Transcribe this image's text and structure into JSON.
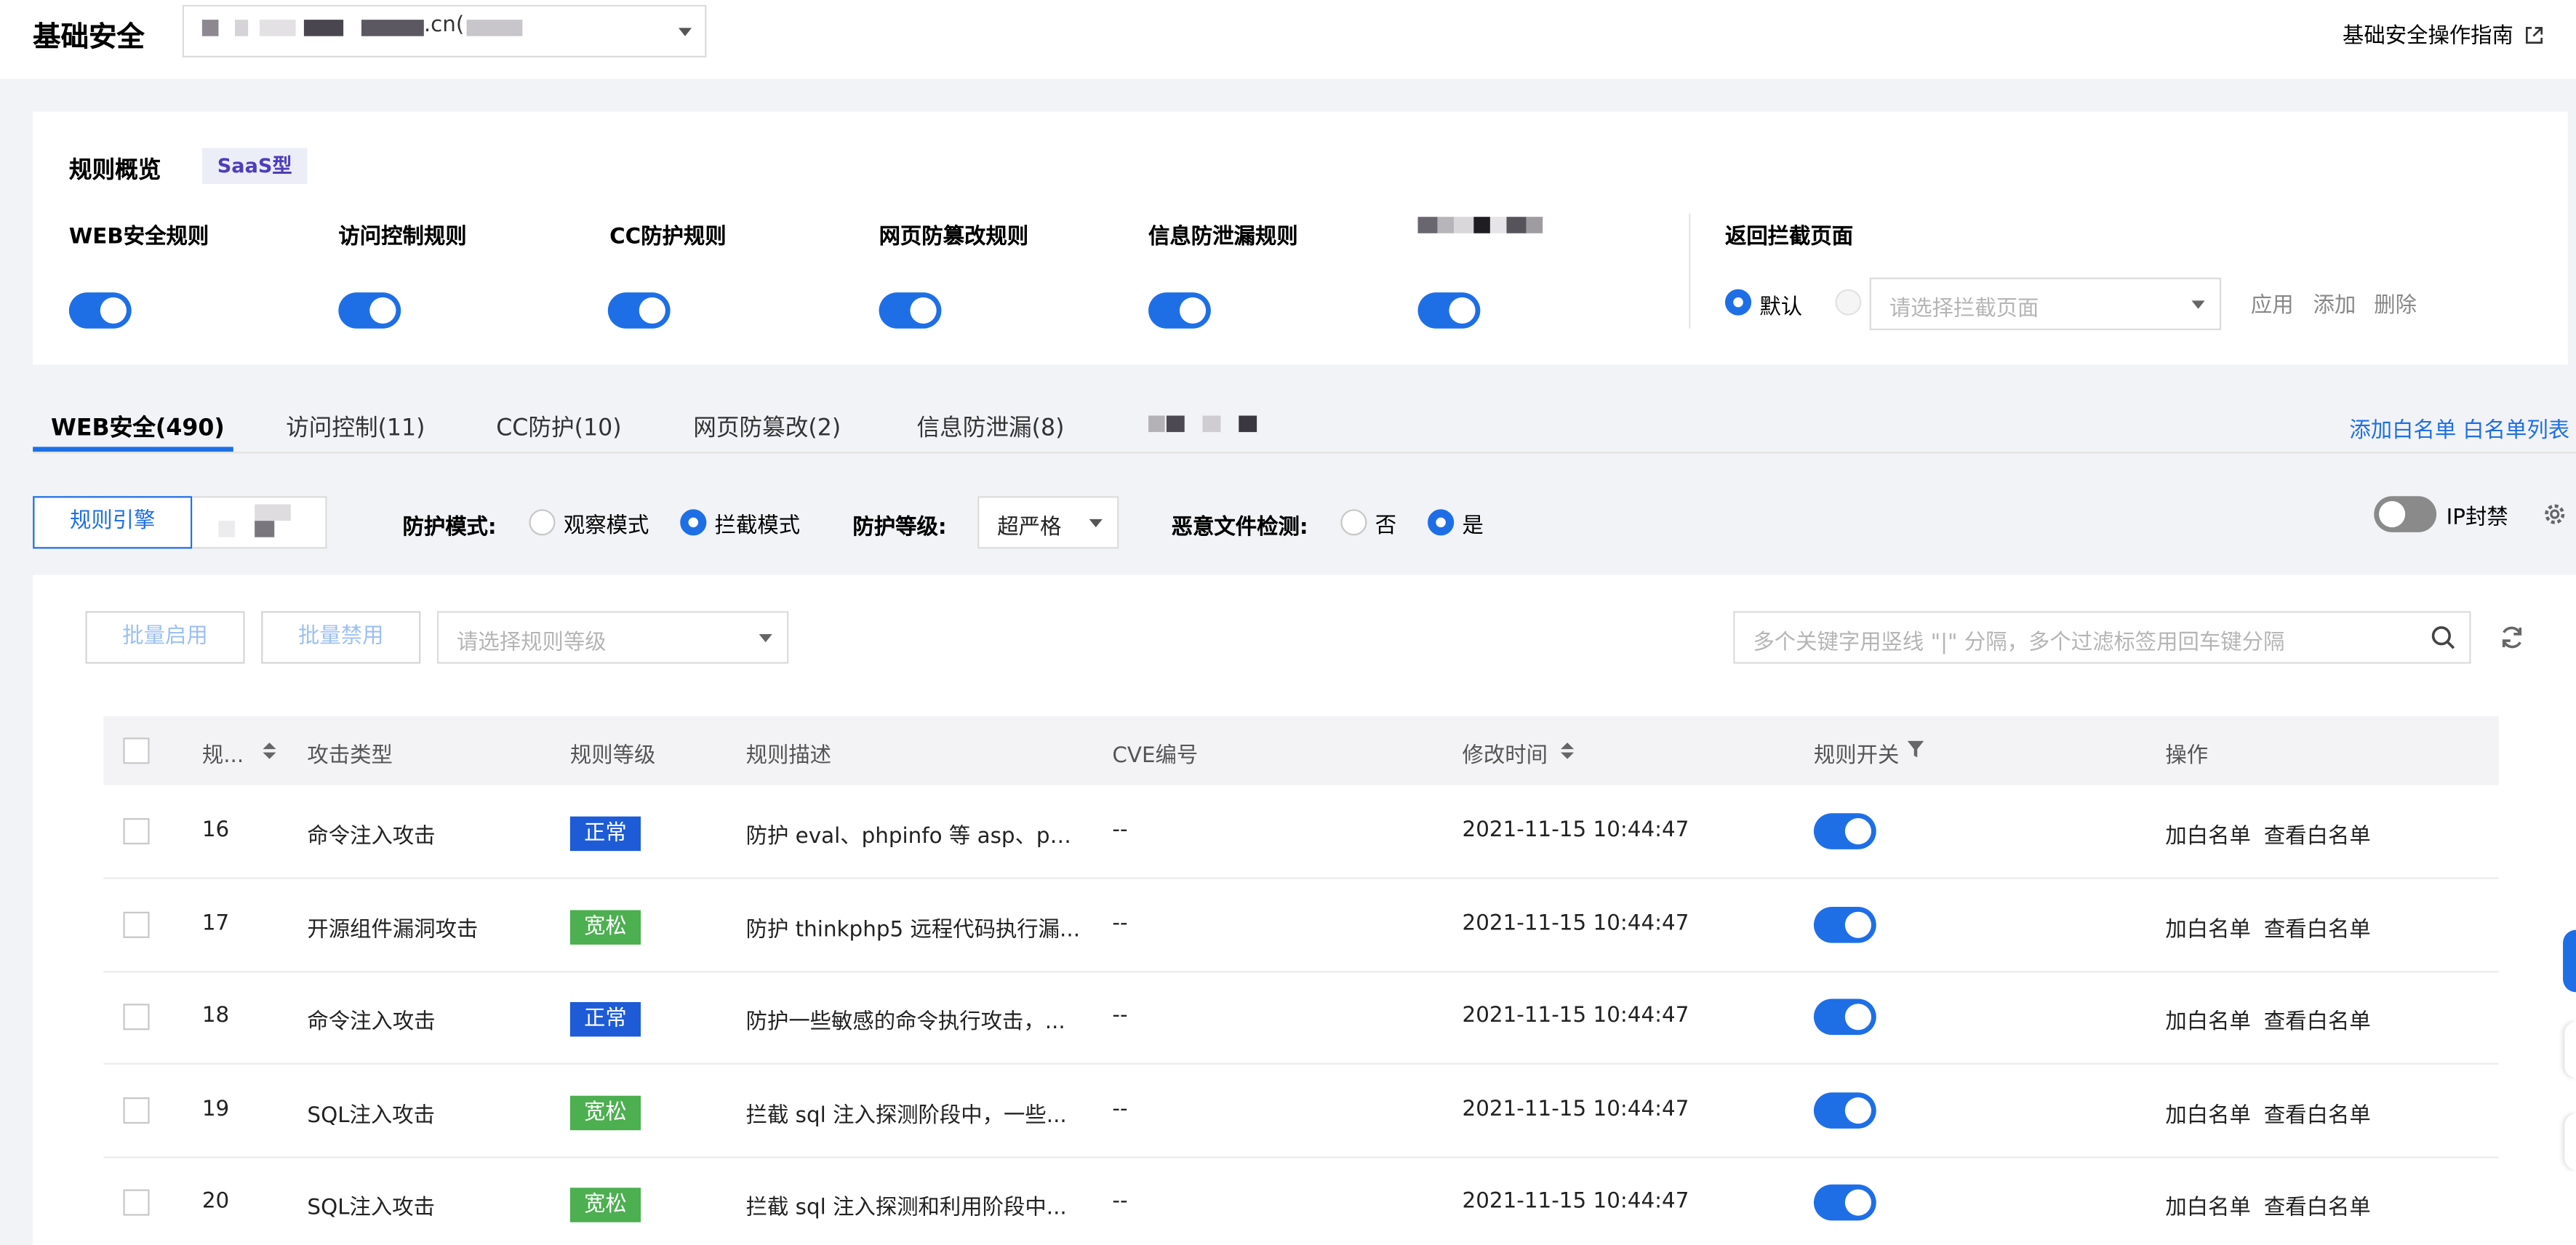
{
  "header": {
    "title": "基础安全",
    "domain_text": ".cn(",
    "guide_link": "基础安全操作指南"
  },
  "overview": {
    "title": "规则概览",
    "badge": "SaaS型",
    "rules": [
      {
        "label": "WEB安全规则",
        "enabled": true
      },
      {
        "label": "访问控制规则",
        "enabled": true
      },
      {
        "label": "CC防护规则",
        "enabled": true
      },
      {
        "label": "网页防篡改规则",
        "enabled": true
      },
      {
        "label": "信息防泄漏规则",
        "enabled": true
      },
      {
        "label": "",
        "enabled": true
      }
    ],
    "block_page": {
      "title": "返回拦截页面",
      "default_label": "默认",
      "select_placeholder": "请选择拦截页面",
      "apply": "应用",
      "add": "添加",
      "delete": "删除"
    }
  },
  "tabs": [
    {
      "label": "WEB安全(490)",
      "active": true
    },
    {
      "label": "访问控制(11)"
    },
    {
      "label": "CC防护(10)"
    },
    {
      "label": "网页防篡改(2)"
    },
    {
      "label": "信息防泄漏(8)"
    }
  ],
  "tab_links": {
    "add_whitelist": "添加白名单",
    "whitelist_list": "白名单列表"
  },
  "settings": {
    "engine_button": "规则引擎",
    "mode_label": "防护模式:",
    "mode_observe": "观察模式",
    "mode_block": "拦截模式",
    "level_label": "防护等级:",
    "level_value": "超严格",
    "malware_label": "恶意文件检测:",
    "malware_no": "否",
    "malware_yes": "是",
    "ip_ban_label": "IP封禁"
  },
  "toolbar": {
    "batch_enable": "批量启用",
    "batch_disable": "批量禁用",
    "level_placeholder": "请选择规则等级",
    "search_placeholder": "多个关键字用竖线 \"|\" 分隔，多个过滤标签用回车键分隔"
  },
  "table": {
    "columns": [
      "规...",
      "攻击类型",
      "规则等级",
      "规则描述",
      "CVE编号",
      "修改时间",
      "规则开关",
      "操作"
    ],
    "rows": [
      {
        "id": "16",
        "type": "命令注入攻击",
        "level": "正常",
        "level_color": "#1e5bd6",
        "desc": "防护 eval、phpinfo 等 asp、php ...",
        "cve": "--",
        "time": "2021-11-15 10:44:47",
        "enabled": true,
        "action1": "加白名单",
        "action2": "查看白名单"
      },
      {
        "id": "17",
        "type": "开源组件漏洞攻击",
        "level": "宽松",
        "level_color": "#4caf50",
        "desc": "防护 thinkphp5 远程代码执行漏...",
        "cve": "--",
        "time": "2021-11-15 10:44:47",
        "enabled": true,
        "action1": "加白名单",
        "action2": "查看白名单"
      },
      {
        "id": "18",
        "type": "命令注入攻击",
        "level": "正常",
        "level_color": "#1e5bd6",
        "desc": "防护一些敏感的命令执行攻击，...",
        "cve": "--",
        "time": "2021-11-15 10:44:47",
        "enabled": true,
        "action1": "加白名单",
        "action2": "查看白名单"
      },
      {
        "id": "19",
        "type": "SQL注入攻击",
        "level": "宽松",
        "level_color": "#4caf50",
        "desc": "拦截 sql 注入探测阶段中，一些...",
        "cve": "--",
        "time": "2021-11-15 10:44:47",
        "enabled": true,
        "action1": "加白名单",
        "action2": "查看白名单"
      },
      {
        "id": "20",
        "type": "SQL注入攻击",
        "level": "宽松",
        "level_color": "#4caf50",
        "desc": "拦截 sql 注入探测和利用阶段中...",
        "cve": "--",
        "time": "2021-11-15 10:44:47",
        "enabled": true,
        "action1": "加白名单",
        "action2": "查看白名单"
      }
    ]
  }
}
